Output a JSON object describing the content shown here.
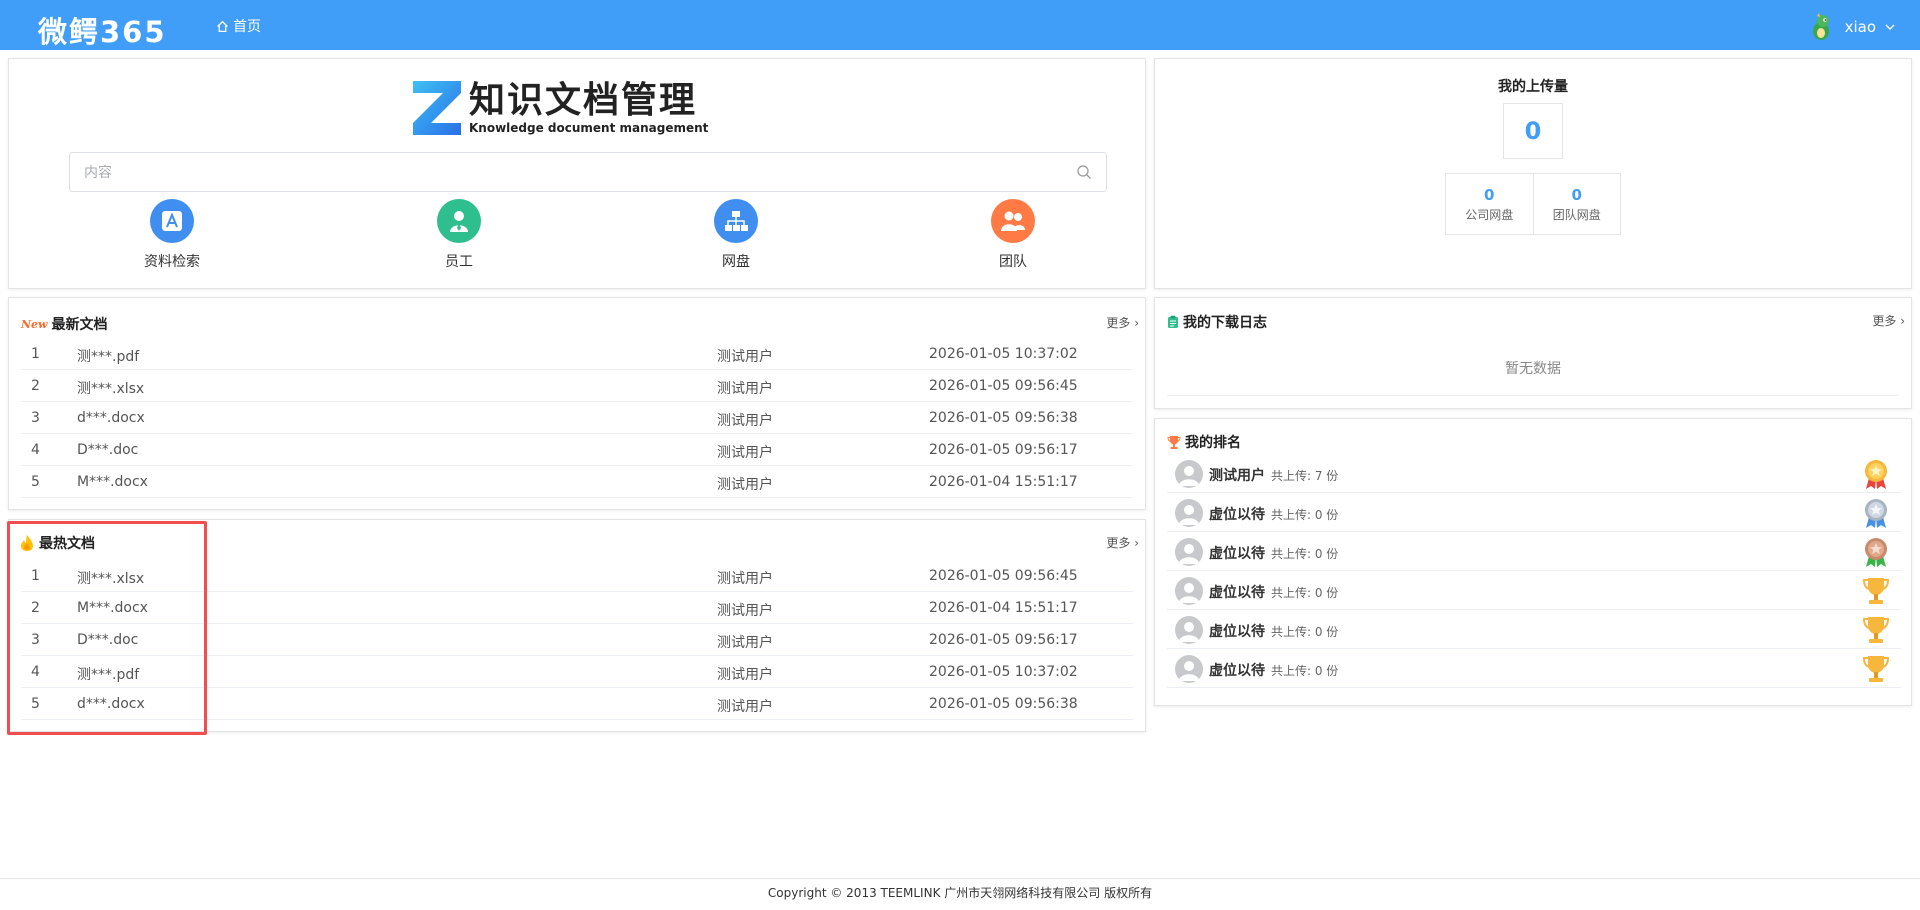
{
  "header": {
    "brand": "微鳄365",
    "home": "首页",
    "username": "xiao"
  },
  "search": {
    "logo_title": "知识文档管理",
    "logo_subtitle": "Knowledge document management",
    "placeholder": "内容",
    "quick_links": [
      {
        "label": "资料检索",
        "icon": "search-doc-icon",
        "color": "#3f8ef0"
      },
      {
        "label": "员工",
        "icon": "employee-icon",
        "color": "#2fbf8f"
      },
      {
        "label": "网盘",
        "icon": "netdisk-icon",
        "color": "#3f8ef0"
      },
      {
        "label": "团队",
        "icon": "team-icon",
        "color": "#ff7a45"
      }
    ]
  },
  "upload": {
    "title": "我的上传量",
    "total": "0",
    "company": {
      "value": "0",
      "label": "公司网盘"
    },
    "team": {
      "value": "0",
      "label": "团队网盘"
    }
  },
  "latest": {
    "badge": "New",
    "title": "最新文档",
    "more": "更多",
    "rows": [
      {
        "idx": "1",
        "name": "测***.pdf",
        "user": "测试用户",
        "time": "2026-01-05 10:37:02"
      },
      {
        "idx": "2",
        "name": "测***.xlsx",
        "user": "测试用户",
        "time": "2026-01-05 09:56:45"
      },
      {
        "idx": "3",
        "name": "d***.docx",
        "user": "测试用户",
        "time": "2026-01-05 09:56:38"
      },
      {
        "idx": "4",
        "name": "D***.doc",
        "user": "测试用户",
        "time": "2026-01-05 09:56:17"
      },
      {
        "idx": "5",
        "name": "M***.docx",
        "user": "测试用户",
        "time": "2026-01-04 15:51:17"
      }
    ]
  },
  "hot": {
    "title": "最热文档",
    "more": "更多",
    "rows": [
      {
        "idx": "1",
        "name": "测***.xlsx",
        "user": "测试用户",
        "time": "2026-01-05 09:56:45"
      },
      {
        "idx": "2",
        "name": "M***.docx",
        "user": "测试用户",
        "time": "2026-01-04 15:51:17"
      },
      {
        "idx": "3",
        "name": "D***.doc",
        "user": "测试用户",
        "time": "2026-01-05 09:56:17"
      },
      {
        "idx": "4",
        "name": "测***.pdf",
        "user": "测试用户",
        "time": "2026-01-05 10:37:02"
      },
      {
        "idx": "5",
        "name": "d***.docx",
        "user": "测试用户",
        "time": "2026-01-05 09:56:38"
      }
    ]
  },
  "download_log": {
    "title": "我的下载日志",
    "more": "更多",
    "empty": "暂无数据"
  },
  "ranking": {
    "title": "我的排名",
    "rows": [
      {
        "name": "测试用户",
        "count": "共上传: 7 份",
        "medal": "gold-medal-icon"
      },
      {
        "name": "虚位以待",
        "count": "共上传: 0 份",
        "medal": "silver-medal-icon"
      },
      {
        "name": "虚位以待",
        "count": "共上传: 0 份",
        "medal": "bronze-medal-icon"
      },
      {
        "name": "虚位以待",
        "count": "共上传: 0 份",
        "medal": "trophy-icon"
      },
      {
        "name": "虚位以待",
        "count": "共上传: 0 份",
        "medal": "trophy-icon"
      },
      {
        "name": "虚位以待",
        "count": "共上传: 0 份",
        "medal": "trophy-icon"
      }
    ]
  },
  "footer": "Copyright © 2013 TEEMLINK 广州市天翎网络科技有限公司 版权所有",
  "colors": {
    "header": "#419ef8",
    "accent": "#419ef8",
    "highlight": "#f04e4e"
  }
}
